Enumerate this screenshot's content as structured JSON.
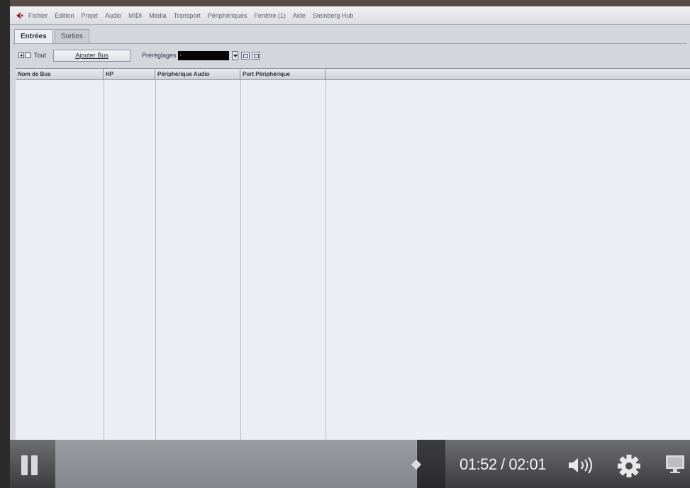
{
  "menubar": {
    "items": [
      "Fichier",
      "Édition",
      "Projet",
      "Audio",
      "MIDI",
      "Média",
      "Transport",
      "Périphériques",
      "Fenêtre (1)",
      "Aide",
      "Steinberg Hub"
    ]
  },
  "tabs": [
    {
      "label": "Entrées",
      "active": true
    },
    {
      "label": "Sorties",
      "active": false
    }
  ],
  "toolbar": {
    "expand_label": "Tout",
    "add_bus_label": "Ajouter Bus",
    "presets_label": "Préréglages",
    "presets_value": "-"
  },
  "table": {
    "columns": [
      "Nom de Bus",
      "HP",
      "Périphérique Audio",
      "Port Périphérique"
    ],
    "rows": []
  },
  "player": {
    "time_display": "01:52 / 02:01",
    "progress_fraction": 0.925
  },
  "colors": {
    "menubar_bg": "#dcdde2",
    "window_bg": "#d4d6dd",
    "table_bg": "#edeef5",
    "logo_red": "#9b1a2b"
  }
}
